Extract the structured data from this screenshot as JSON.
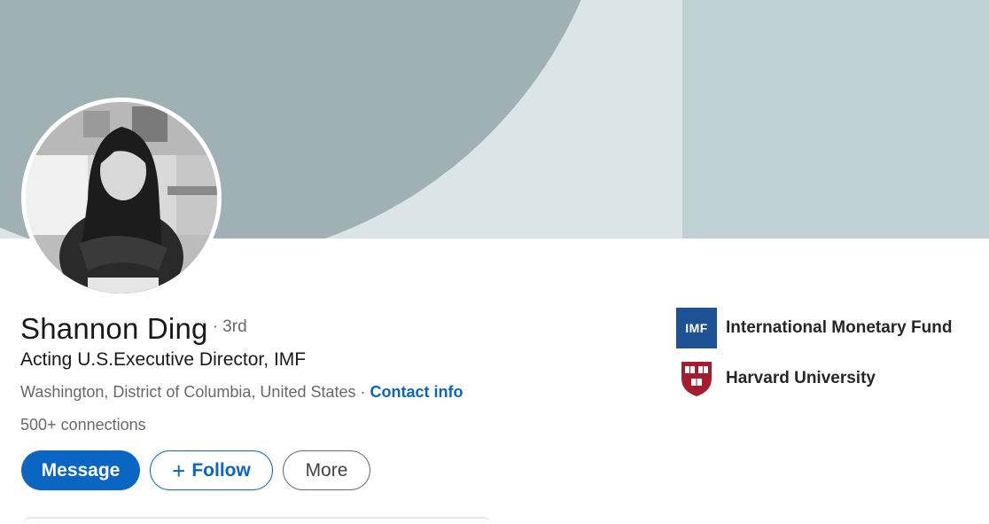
{
  "profile": {
    "name": "Shannon Ding",
    "degree": "· 3rd",
    "headline": "Acting U.S.Executive Director, IMF",
    "location": "Washington, District of Columbia, United States",
    "location_separator": " · ",
    "contact_info_label": "Contact info",
    "connections_count": "500+",
    "connections_label": "connections"
  },
  "actions": {
    "message_label": "Message",
    "follow_icon": "+",
    "follow_label": "Follow",
    "more_label": "More"
  },
  "organizations": [
    {
      "name": "International Monetary Fund",
      "logo_text": "IMF",
      "icon": "imf-logo"
    },
    {
      "name": "Harvard University",
      "icon": "harvard-shield-logo"
    }
  ],
  "colors": {
    "primary": "#0a66c2",
    "banner_light": "#dbe5e8",
    "banner_arc": "#9fb1b4",
    "banner_right": "#bfd1d5",
    "imf_blue": "#1d5394",
    "harvard_crimson": "#a51c30"
  }
}
